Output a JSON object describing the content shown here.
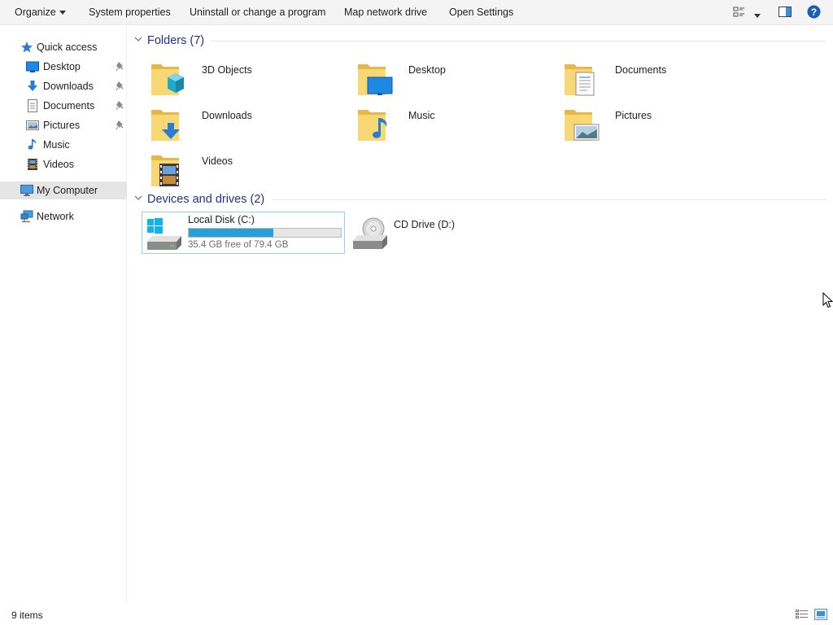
{
  "toolbar": {
    "organize_label": "Organize",
    "system_properties_label": "System properties",
    "uninstall_label": "Uninstall or change a program",
    "map_drive_label": "Map network drive",
    "open_settings_label": "Open Settings",
    "view_options_icon": "view-options-icon",
    "preview_pane_icon": "preview-pane-icon",
    "help_icon": "help-icon"
  },
  "sidebar": {
    "items": [
      {
        "label": "Quick access",
        "icon": "star-icon",
        "pinned": false
      },
      {
        "label": "Desktop",
        "icon": "desktop-icon",
        "pinned": true
      },
      {
        "label": "Downloads",
        "icon": "download-arrow-icon",
        "pinned": true
      },
      {
        "label": "Documents",
        "icon": "document-icon",
        "pinned": true
      },
      {
        "label": "Pictures",
        "icon": "picture-icon",
        "pinned": true
      },
      {
        "label": "Music",
        "icon": "music-note-icon",
        "pinned": false
      },
      {
        "label": "Videos",
        "icon": "film-icon",
        "pinned": false
      },
      {
        "label": "My Computer",
        "icon": "computer-icon",
        "selected": true
      },
      {
        "label": "Network",
        "icon": "network-icon"
      }
    ]
  },
  "folders": {
    "header": "Folders (7)",
    "items": [
      {
        "label": "3D Objects",
        "icon": "3d-objects-folder-icon"
      },
      {
        "label": "Desktop",
        "icon": "desktop-folder-icon"
      },
      {
        "label": "Documents",
        "icon": "documents-folder-icon"
      },
      {
        "label": "Downloads",
        "icon": "downloads-folder-icon"
      },
      {
        "label": "Music",
        "icon": "music-folder-icon"
      },
      {
        "label": "Pictures",
        "icon": "pictures-folder-icon"
      },
      {
        "label": "Videos",
        "icon": "videos-folder-icon"
      }
    ]
  },
  "devices": {
    "header": "Devices and drives (2)",
    "items": [
      {
        "label": "Local Disk (C:)",
        "icon": "windows-drive-icon",
        "free_text": "35.4 GB free of 79.4 GB",
        "used_fraction": 0.554
      },
      {
        "label": "CD Drive (D:)",
        "icon": "cd-drive-icon"
      }
    ]
  },
  "status": {
    "item_count": "9 items",
    "details_view_icon": "details-view-icon",
    "large_icons_view_icon": "large-icons-view-icon"
  },
  "colors": {
    "accent": "#26a0da",
    "folder_yellow": "#f8d775",
    "header_blue": "#1e3287",
    "selection_bg": "#e5e5e5"
  }
}
